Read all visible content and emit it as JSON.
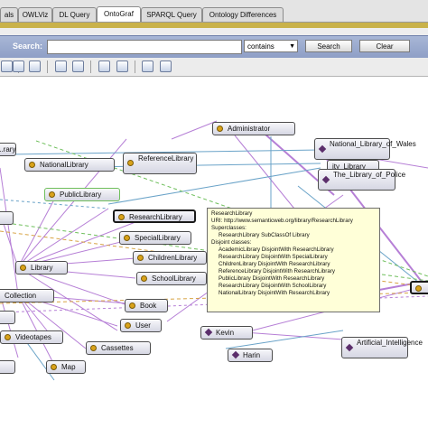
{
  "tabs": [
    {
      "label": "als",
      "active": false
    },
    {
      "label": "OWLViz",
      "active": false
    },
    {
      "label": "DL Query",
      "active": false
    },
    {
      "label": "OntoGraf",
      "active": true
    },
    {
      "label": "SPARQL Query",
      "active": false
    },
    {
      "label": "Ontology Differences",
      "active": false
    }
  ],
  "search": {
    "label": "Search:",
    "value": "",
    "mode": "contains",
    "search_button": "Search",
    "clear_button": "Clear"
  },
  "nodes": {
    "library_left": "...rary",
    "national_library": "NationalLibrary",
    "reference_library": "ReferenceLibrary",
    "public_library": "PublicLibrary",
    "research_library": "ResearchLibrary",
    "special_library": "SpecialLibrary",
    "children_library": "ChildrenLibrary",
    "school_library": "SchoolLibrary",
    "library": "Library",
    "collection": "Collection",
    "book": "Book",
    "user": "User",
    "videotapes": "Videotapes",
    "cassettes": "Cassettes",
    "map": "Map",
    "kevin": "Kevin",
    "harin": "Harin",
    "administrator": "Administrator",
    "national_library_wales": "National_Library_of_Wales",
    "city_library": "ity_Library",
    "library_of_police": "The_Library_of_Police",
    "artificial_intelligence": "Artificial_Intelligence"
  },
  "tooltip": {
    "title": "ResearchLibrary",
    "uri": "URI:  http://www.semanticweb.org/library/ResearchLibrary",
    "superclasses_heading": "Superclasses:",
    "superclasses": [
      "ResearchLibrary SubClassOf Library"
    ],
    "disjoint_heading": "Disjoint classes:",
    "disjoint": [
      "AcademicLibrary DisjointWith ResearchLibrary",
      "ResearchLibrary DisjointWith SpecialLibrary",
      "ChildrenLibrary DisjointWith ResearchLibrary",
      "ReferenceLibrary DisjointWith ResearchLibrary",
      "PublicLibrary DisjointWith ResearchLibrary",
      "ResearchLibrary DisjointWith SchoolLibrary",
      "NationalLibrary DisjointWith ResearchLibrary"
    ]
  },
  "colors": {
    "edge_purple": "#b67fd6",
    "edge_blue": "#6aa3c8",
    "edge_green_dash": "#6fbf5c",
    "edge_orange_dash": "#d7a343",
    "class_dot": "#d9a21a",
    "individual_diamond": "#5b2e6b"
  }
}
